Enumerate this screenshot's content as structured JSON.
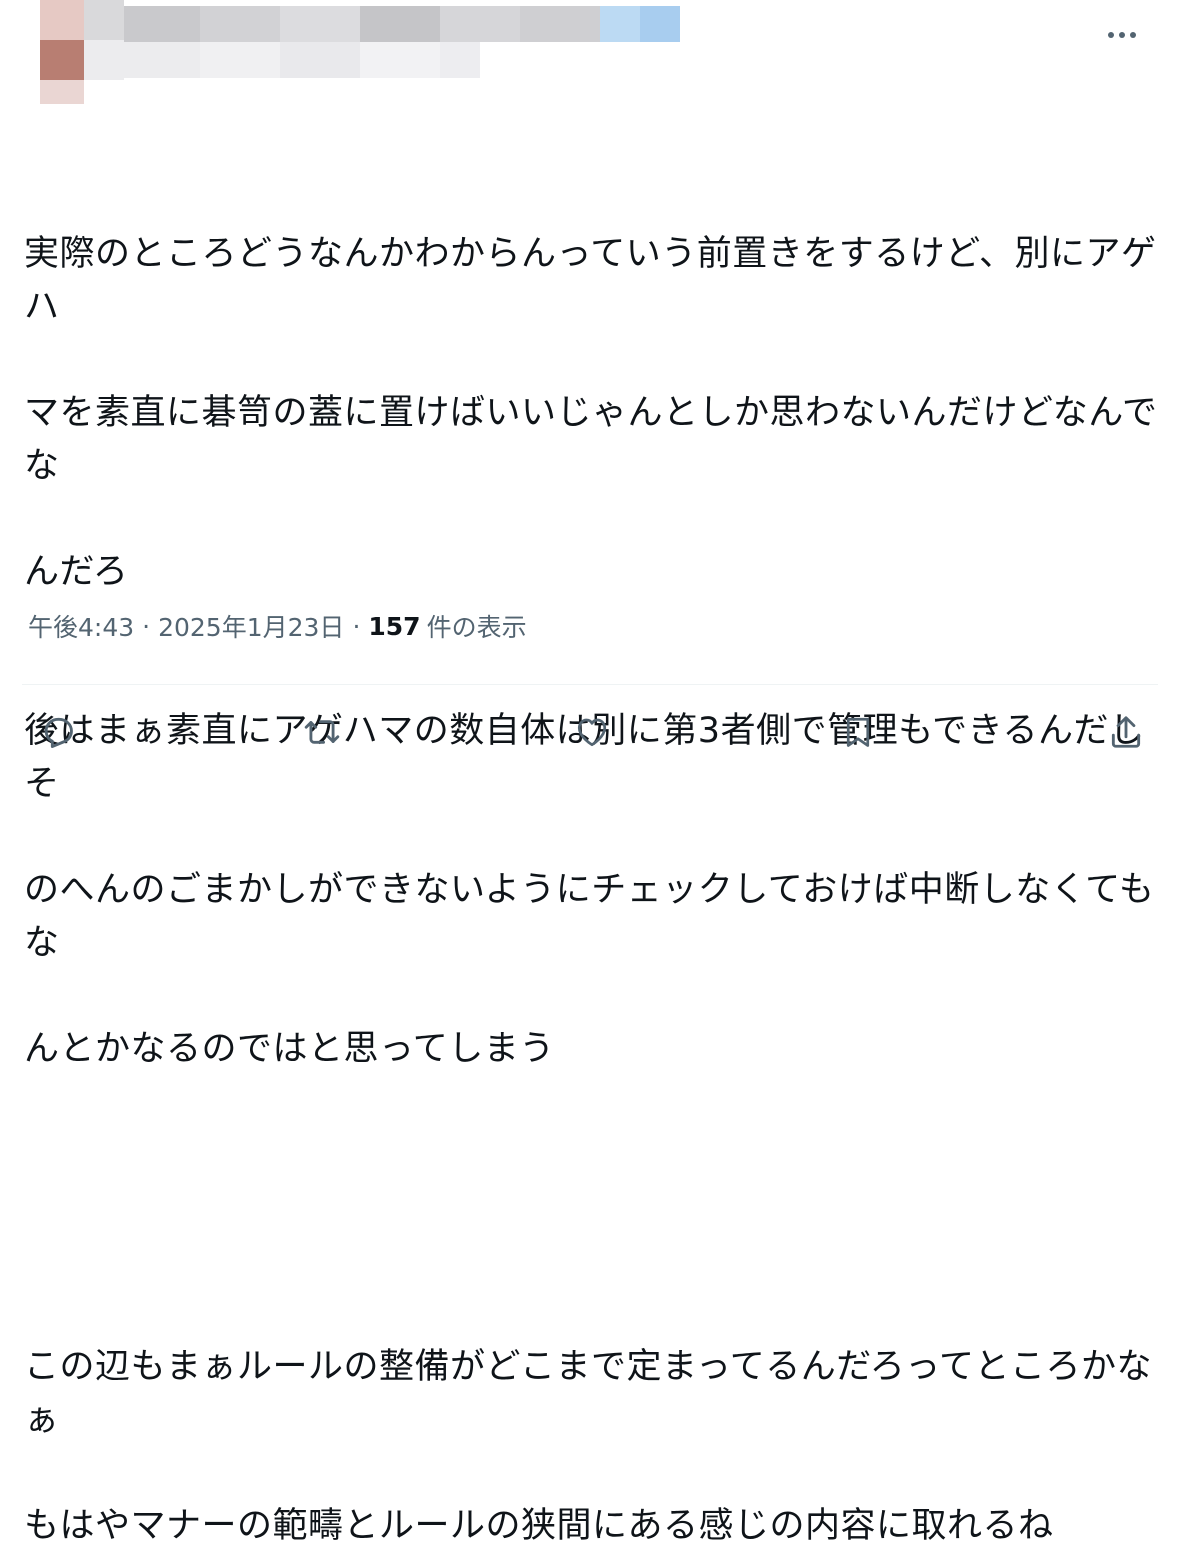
{
  "post": {
    "lines": [
      "実際のところどうなんかわからんっていう前置きをするけど、別にアゲハ",
      "マを素直に碁笥の蓋に置けばいいじゃんとしか思わないんだけどなんでな",
      "んだろ",
      "後はまぁ素直にアゲハマの数自体は別に第3者側で管理もできるんだしそ",
      "のへんのごまかしができないようにチェックしておけば中断しなくてもな",
      "んとかなるのではと思ってしまう",
      "",
      "この辺もまぁルールの整備がどこまで定まってるんだろってところかなぁ",
      "もはやマナーの範疇とルールの狭間にある感じの内容に取れるね"
    ],
    "time": "午後4:43",
    "date": "2025年1月23日",
    "separator": "·",
    "views_count": "157",
    "views_label": "件の表示"
  },
  "icons": {
    "more": "more-dots-icon",
    "reply": "reply-icon",
    "repost": "repost-icon",
    "like": "heart-icon",
    "bookmark": "bookmark-icon",
    "share": "share-icon"
  },
  "colors": {
    "text": "#0f1419",
    "secondary": "#536471",
    "divider": "#eff3f4",
    "icon": "#536471"
  }
}
